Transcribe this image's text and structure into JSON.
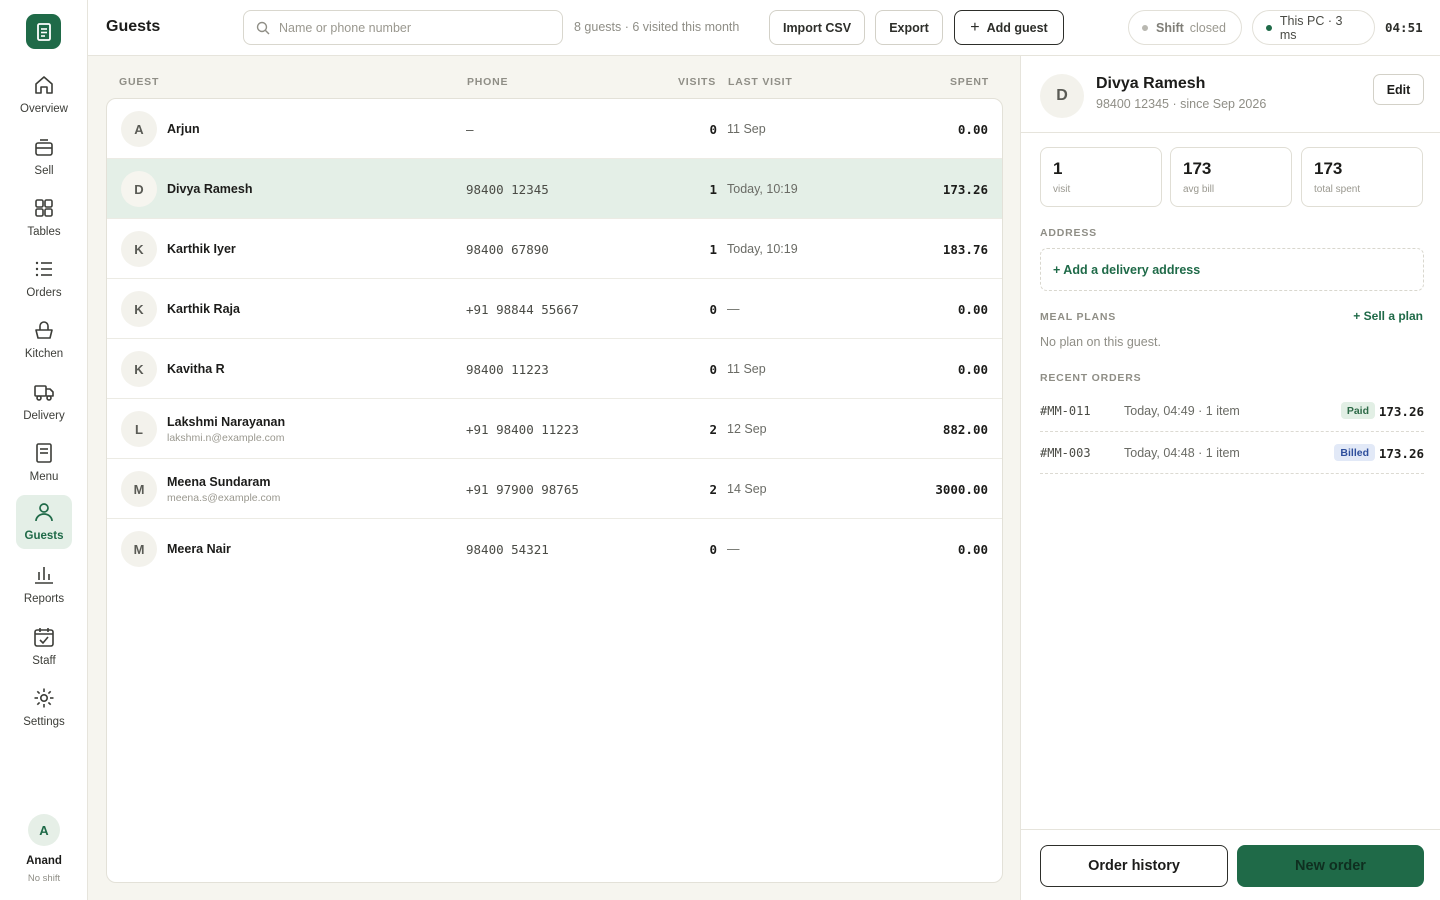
{
  "sidebar": {
    "items": [
      {
        "label": "Overview",
        "icon": "home-icon"
      },
      {
        "label": "Sell",
        "icon": "register-icon"
      },
      {
        "label": "Tables",
        "icon": "grid-icon"
      },
      {
        "label": "Orders",
        "icon": "list-icon"
      },
      {
        "label": "Kitchen",
        "icon": "basket-icon"
      },
      {
        "label": "Delivery",
        "icon": "truck-icon"
      },
      {
        "label": "Menu",
        "icon": "menu-icon"
      },
      {
        "label": "Guests",
        "icon": "user-icon",
        "active": true
      },
      {
        "label": "Reports",
        "icon": "bar-chart-icon"
      },
      {
        "label": "Staff",
        "icon": "calendar-icon"
      },
      {
        "label": "Settings",
        "icon": "gear-icon"
      }
    ],
    "user": {
      "initial": "A",
      "name": "Anand",
      "status": "No shift"
    }
  },
  "header": {
    "title": "Guests",
    "search_placeholder": "Name or phone number",
    "summary": "8 guests · 6 visited this month",
    "import_label": "Import CSV",
    "export_label": "Export",
    "add_label": "Add guest",
    "shift_key": "Shift",
    "shift_value": "closed",
    "pc_status": "This PC · 3 ms",
    "clock": "04:51"
  },
  "table": {
    "columns": {
      "guest": "GUEST",
      "phone": "PHONE",
      "visits": "VISITS",
      "last_visit": "LAST VISIT",
      "spent": "SPENT"
    },
    "rows": [
      {
        "initial": "A",
        "name": "Arjun",
        "email": "",
        "phone": "–",
        "visits": "0",
        "last_visit": "11 Sep",
        "spent": "0.00"
      },
      {
        "initial": "D",
        "name": "Divya Ramesh",
        "email": "",
        "phone": "98400 12345",
        "visits": "1",
        "last_visit": "Today, 10:19",
        "spent": "173.26",
        "selected": true
      },
      {
        "initial": "K",
        "name": "Karthik Iyer",
        "email": "",
        "phone": "98400 67890",
        "visits": "1",
        "last_visit": "Today, 10:19",
        "spent": "183.76"
      },
      {
        "initial": "K",
        "name": "Karthik Raja",
        "email": "",
        "phone": "+91 98844 55667",
        "visits": "0",
        "last_visit": "—",
        "spent": "0.00"
      },
      {
        "initial": "K",
        "name": "Kavitha R",
        "email": "",
        "phone": "98400 11223",
        "visits": "0",
        "last_visit": "11 Sep",
        "spent": "0.00"
      },
      {
        "initial": "L",
        "name": "Lakshmi Narayanan",
        "email": "lakshmi.n@example.com",
        "phone": "+91 98400 11223",
        "visits": "2",
        "last_visit": "12 Sep",
        "spent": "882.00"
      },
      {
        "initial": "M",
        "name": "Meena Sundaram",
        "email": "meena.s@example.com",
        "phone": "+91 97900 98765",
        "visits": "2",
        "last_visit": "14 Sep",
        "spent": "3000.00"
      },
      {
        "initial": "M",
        "name": "Meera Nair",
        "email": "",
        "phone": "98400 54321",
        "visits": "0",
        "last_visit": "—",
        "spent": "0.00"
      }
    ]
  },
  "detail": {
    "initial": "D",
    "name": "Divya Ramesh",
    "subtitle": "98400 12345 · since Sep 2026",
    "edit_label": "Edit",
    "stats": [
      {
        "value": "1",
        "caption": "visit"
      },
      {
        "value": "173",
        "caption": "avg bill"
      },
      {
        "value": "173",
        "caption": "total spent"
      }
    ],
    "address_title": "ADDRESS",
    "address_action": "+ Add a delivery address",
    "meal_plans_title": "MEAL PLANS",
    "sell_plan_label": "+ Sell a plan",
    "no_plan_text": "No plan on this guest.",
    "recent_orders_title": "RECENT ORDERS",
    "orders": [
      {
        "id": "#MM-011",
        "meta": "Today, 04:49 · 1 item",
        "status": "Paid",
        "amount": "173.26"
      },
      {
        "id": "#MM-003",
        "meta": "Today, 04:48 · 1 item",
        "status": "Billed",
        "amount": "173.26"
      }
    ],
    "history_label": "Order history",
    "new_order_label": "New order"
  },
  "colors": {
    "accent": "#1f6a48",
    "selected_row": "#e4efe7",
    "background": "#f6f5ef"
  }
}
